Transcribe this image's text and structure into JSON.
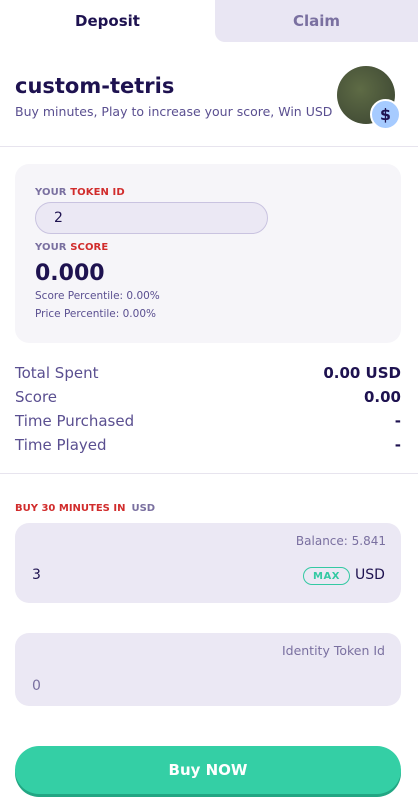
{
  "tabs": {
    "deposit": "Deposit",
    "claim": "Claim"
  },
  "header": {
    "title": "custom-tetris",
    "subtitle": "Buy minutes, Play to increase your score, Win USD",
    "badge_icon": "dollar-icon",
    "badge_symbol": "$"
  },
  "token_card": {
    "token_label_prefix": "YOUR",
    "token_label_key": "TOKEN ID",
    "token_id": "2",
    "score_label_prefix": "YOUR",
    "score_label_key": "SCORE",
    "score": "0.000",
    "score_percentile": "Score Percentile: 0.00%",
    "price_percentile": "Price Percentile: 0.00%"
  },
  "stats": [
    {
      "label": "Total Spent",
      "value": "0.00 USD"
    },
    {
      "label": "Score",
      "value": "0.00"
    },
    {
      "label": "Time Purchased",
      "value": "-"
    },
    {
      "label": "Time Played",
      "value": "-"
    }
  ],
  "buy": {
    "label": "BUY 30 MINUTES IN",
    "currency": "USD",
    "balance": "Balance: 5.841",
    "amount": "3",
    "max_label": "MAX",
    "unit": "USD"
  },
  "identity": {
    "label": "Identity Token Id",
    "value": "0"
  },
  "buy_button_label": "Buy NOW",
  "colors": {
    "primary_text": "#1e1250",
    "accent_green": "#34cfa5",
    "accent_red": "#d12c2c",
    "badge_blue": "#a6cbff"
  }
}
